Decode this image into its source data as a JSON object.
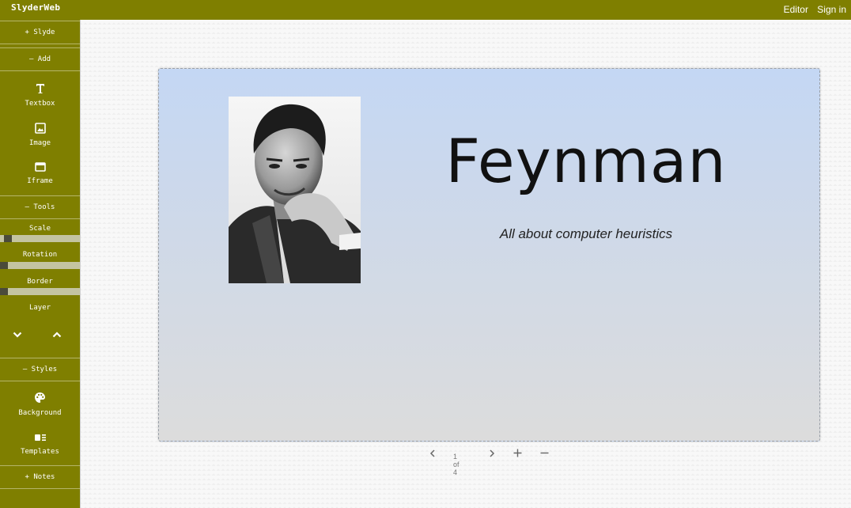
{
  "app": {
    "brand": "SlyderWeb",
    "nav": {
      "editor": "Editor",
      "sign_in": "Sign in"
    }
  },
  "sidebar": {
    "slyde": "+ Slyde",
    "add": "– Add",
    "tools_add": [
      {
        "label": "Textbox",
        "icon": "textbox-icon"
      },
      {
        "label": "Image",
        "icon": "image-icon"
      },
      {
        "label": "Iframe",
        "icon": "iframe-icon"
      }
    ],
    "tools": "– Tools",
    "scale": "Scale",
    "rotation": "Rotation",
    "border": "Border",
    "layer": "Layer",
    "styles": "– Styles",
    "style_tools": [
      {
        "label": "Background",
        "icon": "palette-icon"
      },
      {
        "label": "Templates",
        "icon": "templates-icon"
      }
    ],
    "notes": "+ Notes",
    "slider_values": {
      "scale": 0.05,
      "rotation": 0.0,
      "border": 0.0
    }
  },
  "slide": {
    "title": "Feynman",
    "subtitle": "All about computer heuristics",
    "image_alt": "portrait photo"
  },
  "pager": {
    "count": "1 of 4"
  },
  "colors": {
    "bar": "#7f7f00",
    "slide_top": "#c4d7f4",
    "slide_bottom": "#dcdcdc"
  }
}
